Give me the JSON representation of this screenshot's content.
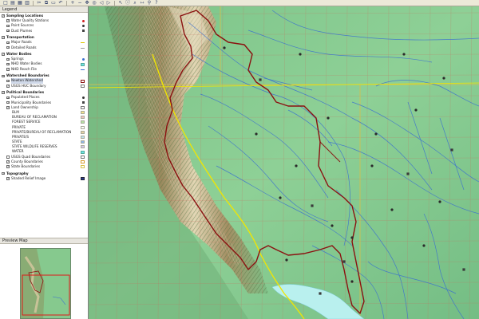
{
  "toolbar": {
    "icons": [
      "new-icon",
      "open-icon",
      "save-icon",
      "print-icon",
      "cut-icon",
      "copy-icon",
      "paste-icon",
      "undo-icon",
      "zoom-in-icon",
      "zoom-out-icon",
      "pan-icon",
      "full-extent-icon",
      "back-icon",
      "forward-icon",
      "select-icon",
      "identify-icon",
      "find-icon",
      "measure-icon",
      "hyperlink-icon",
      "help-icon"
    ]
  },
  "legend": {
    "title": "Legend",
    "items": [
      {
        "label": "Sampling Locations",
        "level": 0,
        "group": true,
        "checked": true
      },
      {
        "label": "Water Quality Stations",
        "level": 1,
        "checked": true,
        "symbol": "dot-red"
      },
      {
        "label": "Point Sources",
        "level": 1,
        "checked": true,
        "symbol": "dot-dark"
      },
      {
        "label": "Dust Plumes",
        "level": 1,
        "checked": true,
        "symbol": "square-dark"
      },
      {
        "label": "",
        "level": 0,
        "spacer": true
      },
      {
        "label": "Transportation",
        "level": 0,
        "group": true,
        "checked": true
      },
      {
        "label": "Major Roads",
        "level": 1,
        "checked": true,
        "symbol": "line-yellow"
      },
      {
        "label": "Detailed Roads",
        "level": 1,
        "checked": true,
        "symbol": "line-gray"
      },
      {
        "label": "",
        "level": 0,
        "spacer": true
      },
      {
        "label": "Water Bodies",
        "level": 0,
        "group": true,
        "checked": true
      },
      {
        "label": "Springs",
        "level": 1,
        "checked": true,
        "symbol": "dot-blue"
      },
      {
        "label": "NHD Water Bodies",
        "level": 1,
        "checked": true,
        "symbol": "fill-cyan"
      },
      {
        "label": "NHD Reach File",
        "level": 1,
        "checked": true,
        "symbol": "line-blue"
      },
      {
        "label": "",
        "level": 0,
        "spacer": true
      },
      {
        "label": "Watershed Boundaries",
        "level": 0,
        "group": true,
        "checked": true
      },
      {
        "label": "Newton Watershed",
        "level": 1,
        "checked": true,
        "selected": true,
        "symbol": "box-darkred"
      },
      {
        "label": "USGS HUC Boundary",
        "level": 1,
        "checked": true,
        "symbol": "box-gray"
      },
      {
        "label": "",
        "level": 0,
        "spacer": true
      },
      {
        "label": "Political Boundaries",
        "level": 0,
        "group": true,
        "checked": true
      },
      {
        "label": "Populated Places",
        "level": 1,
        "checked": true,
        "symbol": "dot-dark"
      },
      {
        "label": "Municipality Boundaries",
        "level": 1,
        "checked": true,
        "symbol": "square-dark"
      },
      {
        "label": "Land Ownership",
        "level": 1,
        "checked": true,
        "symbol": "box-gray"
      },
      {
        "label": "BLM",
        "level": 2,
        "symbol": "fill-yellow"
      },
      {
        "label": "BUREAU OF RECLAMATION",
        "level": 2,
        "symbol": "fill-pink"
      },
      {
        "label": "FOREST SERVICE",
        "level": 2,
        "symbol": "fill-green"
      },
      {
        "label": "PRIVATE",
        "level": 2,
        "symbol": "fill-white"
      },
      {
        "label": "PRIVATE/BUREAU OF RECLAMATION",
        "level": 2,
        "symbol": "fill-tan"
      },
      {
        "label": "PRIVATE/S",
        "level": 2,
        "symbol": "fill-lightblue"
      },
      {
        "label": "STATE",
        "level": 2,
        "symbol": "fill-blue"
      },
      {
        "label": "STATE WILDLIFE RESERVES",
        "level": 2,
        "symbol": "fill-lavender"
      },
      {
        "label": "WATER",
        "level": 2,
        "symbol": "fill-cyan"
      },
      {
        "label": "USGS Quad Boundaries",
        "level": 1,
        "checked": false,
        "symbol": "box-gray"
      },
      {
        "label": "County Boundaries",
        "level": 1,
        "checked": true,
        "symbol": "box-orange"
      },
      {
        "label": "State Boundaries",
        "level": 1,
        "checked": true,
        "symbol": "box-yellow"
      },
      {
        "label": "",
        "level": 0,
        "spacer": true
      },
      {
        "label": "Topography",
        "level": 0,
        "group": true,
        "checked": true
      },
      {
        "label": "Shaded Relief Image",
        "level": 1,
        "checked": true,
        "symbol": "fill-navy"
      }
    ]
  },
  "preview": {
    "title": "Preview Map"
  },
  "colors": {
    "lowland": "#86c98e",
    "upland": "#6fb57e",
    "ridge": "#b8a37c",
    "peak": "#e8e0c8",
    "stream": "#3a6fd0",
    "watershed": "#8b1010",
    "major_road": "#f2e600",
    "section_lines": "#c96a5a",
    "county": "#d9c04a",
    "water_body": "#b9f0ee"
  }
}
